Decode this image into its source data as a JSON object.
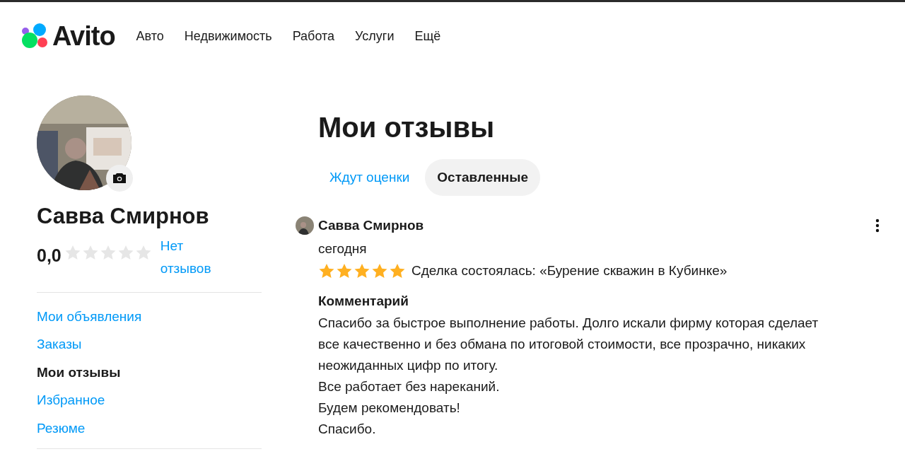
{
  "header": {
    "logo": "Avito",
    "nav": [
      "Авто",
      "Недвижимость",
      "Работа",
      "Услуги",
      "Ещё"
    ]
  },
  "profile": {
    "name": "Савва Смирнов",
    "rating": "0,0",
    "stars": 0,
    "reviews_link": "Нет отзывов"
  },
  "sidebar": {
    "items": [
      {
        "label": "Мои объявления",
        "selected": false
      },
      {
        "label": "Заказы",
        "selected": false
      },
      {
        "label": "Мои отзывы",
        "selected": true
      },
      {
        "label": "Избранное",
        "selected": false
      },
      {
        "label": "Резюме",
        "selected": false
      }
    ]
  },
  "page_title": "Мои отзывы",
  "tabs": [
    {
      "label": "Ждут оценки",
      "selected": false
    },
    {
      "label": "Оставленные",
      "selected": true
    }
  ],
  "reviews": [
    {
      "author": "Савва Смирнов",
      "date": "сегодня",
      "stars": 5,
      "deal": "Сделка состоялась: «Бурение скважин в Кубинке»",
      "comment_label": "Комментарий",
      "comment": "Спасибо за быстрое выполнение работы. Долго искали фирму которая сделает все качественно и без обмана по итоговой стоимости, все прозрачно, никаких неожиданных цифр по итогу.\nВсе работает без нареканий.\nБудем рекомендовать!\nСпасибо."
    }
  ]
}
